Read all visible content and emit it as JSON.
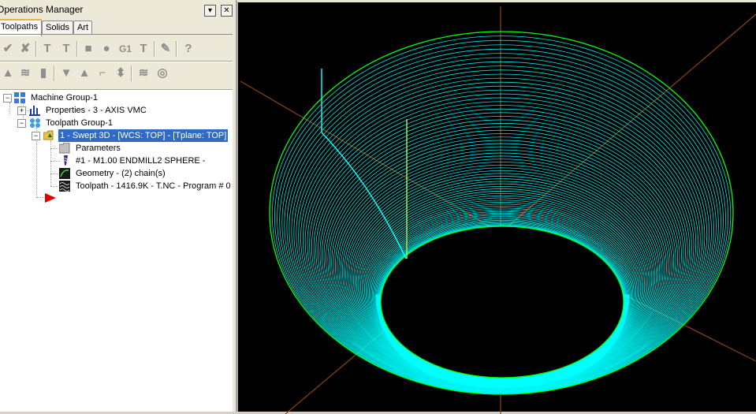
{
  "panel": {
    "title": "Operations Manager",
    "tabs": [
      {
        "label": "Toolpaths",
        "active": true
      },
      {
        "label": "Solids",
        "active": false
      },
      {
        "label": "Art",
        "active": false
      }
    ]
  },
  "toolbar": {
    "row1": [
      {
        "icon": "select-all-icon",
        "glyph": "✔"
      },
      {
        "icon": "deselect-icon",
        "glyph": "✘"
      },
      {
        "icon": "regenerate-icon",
        "glyph": "T"
      },
      {
        "icon": "regenerate-dirty-icon",
        "glyph": "T"
      },
      {
        "icon": "backplot-icon",
        "glyph": "■"
      },
      {
        "icon": "verify-icon",
        "glyph": "●"
      },
      {
        "icon": "post-icon",
        "glyph": "G1"
      },
      {
        "icon": "highfeed-icon",
        "glyph": "T"
      },
      {
        "icon": "delete-icon",
        "glyph": "✎"
      },
      {
        "icon": "help-icon",
        "glyph": "?"
      }
    ],
    "row2": [
      {
        "icon": "lock-icon",
        "glyph": "▲"
      },
      {
        "icon": "toggle-display-icon",
        "glyph": "≋"
      },
      {
        "icon": "toggle-posting-icon",
        "glyph": "▮"
      },
      {
        "icon": "move-down-icon",
        "glyph": "▼"
      },
      {
        "icon": "move-up-icon",
        "glyph": "▲"
      },
      {
        "icon": "insert-arrow-icon",
        "glyph": "⌐"
      },
      {
        "icon": "move-insert-icon",
        "glyph": "⬍"
      },
      {
        "icon": "scroll-icon",
        "glyph": "≋"
      },
      {
        "icon": "single-display-icon",
        "glyph": "◎"
      }
    ]
  },
  "tree": {
    "machine_group": "Machine Group-1",
    "properties": "Properties - 3 - AXIS VMC",
    "toolpath_group": "Toolpath Group-1",
    "operation": "1 - Swept 3D - [WCS: TOP] - [Tplane: TOP]",
    "parameters": "Parameters",
    "tool": "#1 - M1.00 ENDMILL2 SPHERE -",
    "geometry": "Geometry - (2) chain(s)",
    "toolpath": "Toolpath - 1416.9K - T.NC - Program # 0"
  },
  "viewport": {
    "background": "#000000",
    "toolpath_color": "#00ffff",
    "boundary_color": "#00ff00",
    "axis_color": "#8b4513"
  }
}
